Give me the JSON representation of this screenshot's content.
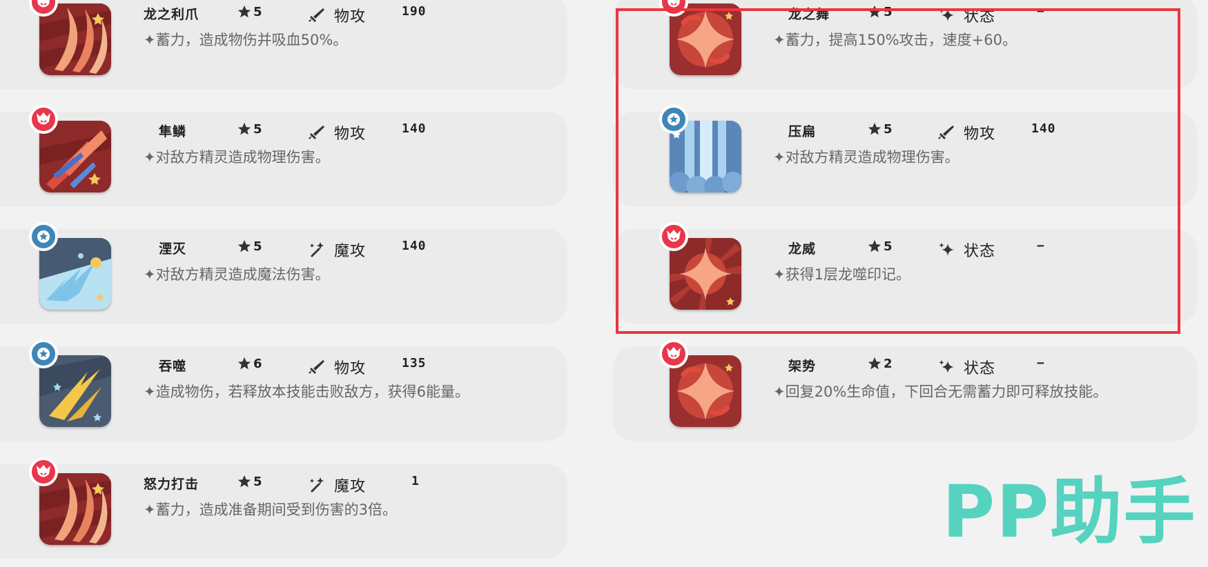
{
  "skills_left": [
    {
      "name": "龙之利爪",
      "cost": "5",
      "type": "物攻",
      "power": "190",
      "desc": "✦蓄力，造成物伤并吸血50%。"
    },
    {
      "name": "隼鳞",
      "cost": "5",
      "type": "物攻",
      "power": "140",
      "desc": "✦对敌方精灵造成物理伤害。"
    },
    {
      "name": "湮灭",
      "cost": "5",
      "type": "魔攻",
      "power": "140",
      "desc": "✦对敌方精灵造成魔法伤害。"
    },
    {
      "name": "吞噬",
      "cost": "6",
      "type": "物攻",
      "power": "135",
      "desc": "✦造成物伤，若释放本技能击败敌方，获得6能量。"
    },
    {
      "name": "怒力打击",
      "cost": "5",
      "type": "魔攻",
      "power": "1",
      "desc": "✦蓄力，造成准备期间受到伤害的3倍。"
    }
  ],
  "skills_right": [
    {
      "name": "龙之舞",
      "cost": "5",
      "type": "状态",
      "power": "−",
      "desc": "✦蓄力，提高150%攻击，速度+60。"
    },
    {
      "name": "压扁",
      "cost": "5",
      "type": "物攻",
      "power": "140",
      "desc": "✦对敌方精灵造成物理伤害。"
    },
    {
      "name": "龙威",
      "cost": "5",
      "type": "状态",
      "power": "−",
      "desc": "✦获得1层龙噬印记。"
    },
    {
      "name": "架势",
      "cost": "2",
      "type": "状态",
      "power": "−",
      "desc": "✦回复20%生命值，下回合无需蓄力即可释放技能。"
    }
  ],
  "watermark": "PP助手",
  "colors": {
    "highlight": "#e8373f",
    "badge_red": "#e8374a",
    "badge_blue": "#3f86b8",
    "watermark": "#55d3bf"
  }
}
